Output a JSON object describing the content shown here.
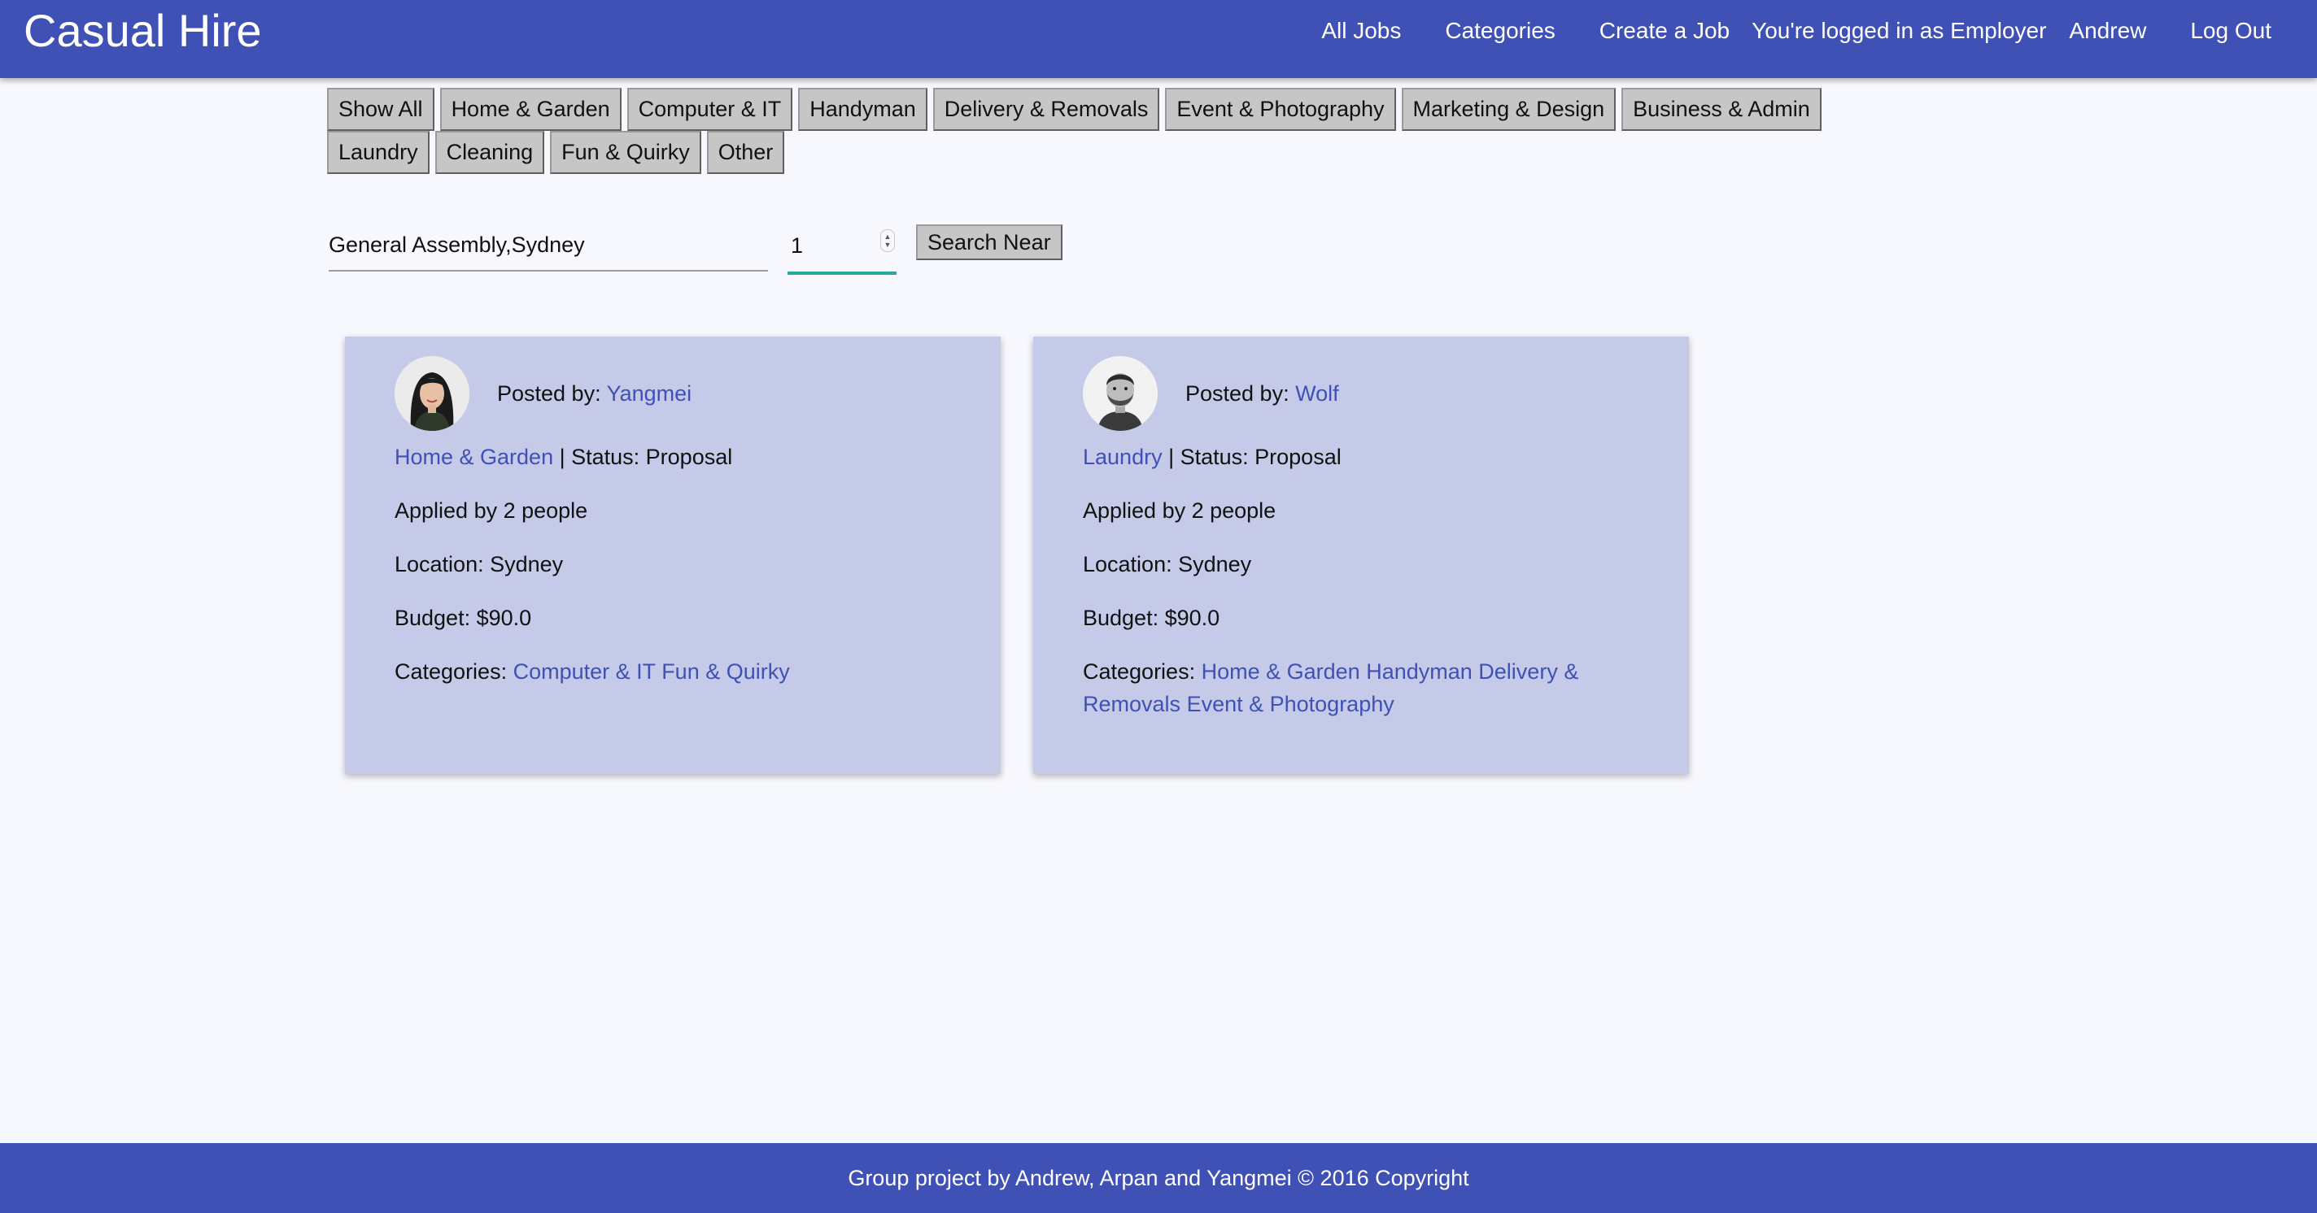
{
  "navbar": {
    "brand": "Casual Hire",
    "links": {
      "all_jobs": "All Jobs",
      "categories": "Categories",
      "create_job": "Create a Job",
      "login_status": "You're logged in as Employer",
      "user": "Andrew",
      "logout": "Log Out"
    }
  },
  "category_filters": [
    "Show All",
    "Home & Garden",
    "Computer & IT",
    "Handyman",
    "Delivery & Removals",
    "Event & Photography",
    "Marketing & Design",
    "Business & Admin",
    "Laundry",
    "Cleaning",
    "Fun & Quirky",
    "Other"
  ],
  "search": {
    "location_value": "General Assembly,Sydney",
    "distance_value": "1",
    "button_label": "Search Near"
  },
  "jobs": [
    {
      "posted_by_label": "Posted by:",
      "poster": "Yangmei",
      "category": "Home & Garden",
      "status": " | Status: Proposal",
      "applied": "Applied by 2 people",
      "location": "Location: Sydney",
      "budget": "Budget: $90.0",
      "categories_label": "Categories:",
      "categories": [
        "Computer & IT",
        "Fun & Quirky"
      ]
    },
    {
      "posted_by_label": "Posted by:",
      "poster": "Wolf",
      "category": "Laundry",
      "status": " | Status: Proposal",
      "applied": "Applied by 2 people",
      "location": "Location: Sydney",
      "budget": "Budget: $90.0",
      "categories_label": "Categories:",
      "categories": [
        "Home & Garden",
        "Handyman",
        "Delivery & Removals",
        "Event & Photography"
      ]
    }
  ],
  "footer": {
    "text": "Group project by Andrew, Arpan and Yangmei © 2016 Copyright"
  },
  "colors": {
    "primary": "#3f51b5",
    "card_background": "#c5cae9",
    "input_focus": "#26a69a",
    "page_background": "#f7f8fd"
  },
  "icons": {
    "stepper": "number-stepper-arrows-icon"
  }
}
